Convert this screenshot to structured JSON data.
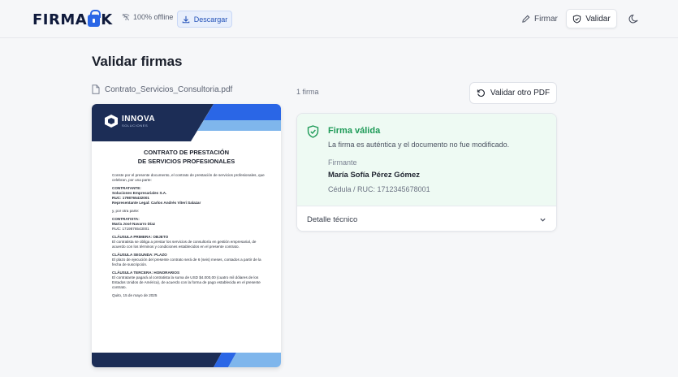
{
  "header": {
    "logo_left": "FIRMA",
    "logo_right": "K",
    "offline_status": "100% offline",
    "download_label": "Descargar",
    "nav": {
      "sign_label": "Firmar",
      "validate_label": "Validar"
    }
  },
  "page": {
    "title": "Validar firmas",
    "file_name": "Contrato_Servicios_Consultoria.pdf"
  },
  "document": {
    "brand_name": "INNOVA",
    "brand_sub": "SOLUCIONES",
    "title_line1": "CONTRATO DE PRESTACIÓN",
    "title_line2": "DE SERVICIOS PROFESIONALES",
    "intro": "Conste por el presente documento, el contrato de prestación de servicios profesionales, que celebran, por una parte:",
    "contratante_heading": "CONTRATANTE:",
    "contratante_company": "Soluciones Empresariales S.A.",
    "contratante_ruc": "RUC: 1798765432001",
    "contratante_rep": "Representante Legal: Carlos Andrés Viteri Salazar",
    "other_party": "y, por otra parte:",
    "contratista_heading": "CONTRATISTA:",
    "contratista_name": "María José Navarro Díaz",
    "contratista_ruc": "RUC: 1719876543001",
    "clause1_heading": "CLÁUSULA PRIMERA: OBJETO",
    "clause1_text": "El contratista se obliga a prestar los servicios de consultoría en gestión empresarial, de acuerdo con los términos y condiciones establecidos en el presente contrato.",
    "clause2_heading": "CLÁUSULA SEGUNDA: PLAZO",
    "clause2_text": "El plazo de ejecución del presente contrato será de 6 (seis) meses, contados a partir de la fecha de suscripción.",
    "clause3_heading": "CLÁUSULA TERCERA: HONORARIOS",
    "clause3_text": "El contratante pagará al contratista la suma de USD $4.000,00 (cuatro mil dólares de los Estados Unidos de América), de acuerdo con la forma de pago establecida en el presente contrato.",
    "date_line": "Quito, 15 de mayo de 2025"
  },
  "signatures": {
    "count_label": "1 firma",
    "validate_other_label": "Validar otro PDF",
    "card": {
      "status_title": "Firma válida",
      "status_desc": "La firma es auténtica y el documento no fue modificado.",
      "signer_label": "Firmante",
      "signer_name": "María Sofía Pérez Gómez",
      "signer_id": "Cédula / RUC: 1712345678001",
      "tech_detail_label": "Detalle técnico"
    }
  },
  "colors": {
    "accent_blue": "#2a66e6",
    "valid_green": "#1d9a57",
    "doc_navy": "#1c2d56"
  }
}
